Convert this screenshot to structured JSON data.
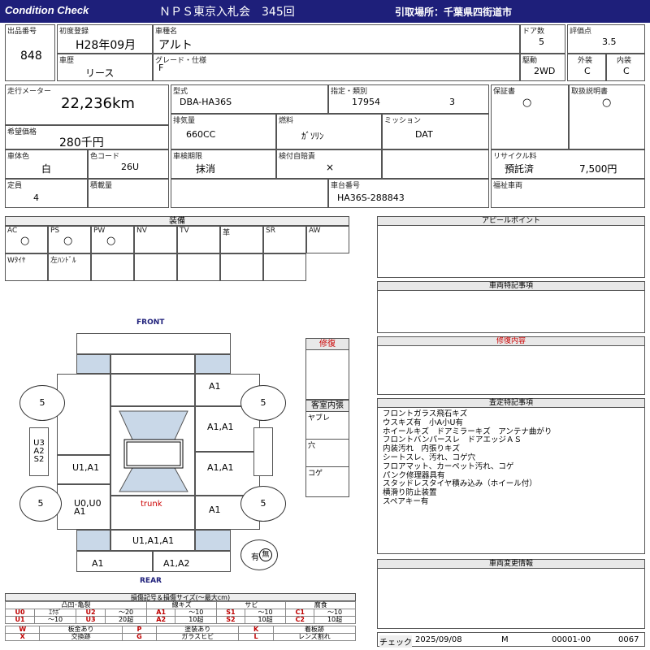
{
  "header": {
    "logo": "Condition Check",
    "auction": "ＮＰＳ東京入札会　345回",
    "pickup": "引取場所：千葉県四街道市"
  },
  "fields": {
    "lot_label": "出品番号",
    "lot": "848",
    "first_reg_label": "初度登録",
    "first_reg": "H28年09月",
    "name_label": "車種名",
    "name": "アルト",
    "doors_label": "ドア数",
    "doors": "5",
    "rating_label": "評価点",
    "rating": "3.5",
    "history_label": "車歴",
    "history": "リース",
    "grade_label": "グレード・仕様",
    "grade": "F",
    "drive_label": "駆動",
    "drive": "2WD",
    "ext_label": "外装",
    "ext": "C",
    "int_label": "内装",
    "int": "C",
    "mileage_label": "走行メーター",
    "mileage": "22,236km",
    "model_label": "型式",
    "model": "DBA-HA36S",
    "designation_label": "指定・類別",
    "designation": "17954",
    "category": "3",
    "warranty_label": "保証書",
    "warranty": "○",
    "manual_label": "取扱説明書",
    "manual": "○",
    "price_label": "希望価格",
    "price": "280千円",
    "displacement_label": "排気量",
    "displacement": "660CC",
    "fuel_label": "燃料",
    "fuel": "ｶﾞｿﾘﾝ",
    "mission_label": "ミッション",
    "mission": "DAT",
    "color_label": "車体色",
    "color": "白",
    "colorcode_label": "色コード",
    "colorcode": "26U",
    "inspection_label": "車検期限",
    "inspection": "抹消",
    "insurance_label": "検付自賠責",
    "insurance": "×",
    "recycle_label": "リサイクル料",
    "recycle_status": "預託済",
    "recycle_fee": "7,500円",
    "capacity_label": "定員",
    "capacity": "4",
    "load_label": "積載量",
    "chassis_label": "車台番号",
    "chassis": "HA36S-288843",
    "welfare_label": "福祉車両"
  },
  "equipment": {
    "title": "装備",
    "row1": [
      {
        "label": "AC",
        "mark": "○"
      },
      {
        "label": "PS",
        "mark": "○"
      },
      {
        "label": "PW",
        "mark": "○"
      },
      {
        "label": "NV",
        "mark": ""
      },
      {
        "label": "TV",
        "mark": ""
      },
      {
        "label": "革",
        "mark": ""
      },
      {
        "label": "SR",
        "mark": ""
      },
      {
        "label": "AW",
        "mark": ""
      }
    ],
    "row2": [
      {
        "label": "Wﾀｲﾔ"
      },
      {
        "label": "左ﾊﾝﾄﾞﾙ"
      },
      {
        "label": ""
      },
      {
        "label": ""
      },
      {
        "label": ""
      },
      {
        "label": ""
      },
      {
        "label": ""
      }
    ]
  },
  "diagram": {
    "front": "FRONT",
    "rear": "REAR",
    "trunk": "trunk",
    "tires": [
      "5",
      "5",
      "5",
      "5"
    ],
    "side_glass": [
      "U3",
      "A2",
      "S2"
    ],
    "marks": {
      "fl_fender": "A1",
      "f_door_r": "A1,A1",
      "r_door_r": "A1,A1",
      "q_r": "A1",
      "f_door_l": "U1,A1",
      "q_l": "U0,U0\nA1",
      "rear_bumper": "U1,A1,A1",
      "rl": "A1",
      "rr": "A1,A2"
    },
    "spare": "有",
    "spare_mark": "無"
  },
  "repair": {
    "title": "修復"
  },
  "interior": {
    "title": "客室内張",
    "items": [
      "ヤブレ",
      "穴",
      "コゲ"
    ]
  },
  "panels": {
    "appeal": {
      "title": "アピールポイント",
      "text": ""
    },
    "special": {
      "title": "車両特記事項",
      "text": ""
    },
    "repair_detail": {
      "title": "修復内容",
      "text": ""
    },
    "inspection": {
      "title": "査定特記事項",
      "lines": [
        "フロントガラス飛石キズ",
        "ウスキズ有　小A小U有",
        "ホイールキズ　ドアミラーキズ　アンテナ曲がり",
        "フロントバンパースレ　ドアエッジＡＳ",
        "内装汚れ　内張りキズ",
        "シートスレ、汚れ、コゲ穴",
        "フロアマット、カーペット汚れ、コゲ",
        "パンク修理器具有",
        "スタッドレスタイヤ積み込み（ホイール付）",
        "横滑り防止装置",
        "スペアキー有"
      ]
    },
    "change": {
      "title": "車両変更情報",
      "text": ""
    }
  },
  "legend": {
    "title": "損傷記号＆損傷サイズ(～最大cm)",
    "groups": [
      "凸凹･亀裂",
      "線キズ",
      "サビ",
      "腐食"
    ],
    "rows": [
      [
        "U0",
        "ｴｸﾎﾞ",
        "U2",
        "～20",
        "A1",
        "～10",
        "S1",
        "～10",
        "C1",
        "～10"
      ],
      [
        "U1",
        "～10",
        "U3",
        "20超",
        "A2",
        "10超",
        "S2",
        "10超",
        "C2",
        "10超"
      ]
    ],
    "codes": [
      [
        "W",
        "板金あり",
        "P",
        "塗装あり",
        "K",
        "着板跡"
      ],
      [
        "X",
        "交換跡",
        "G",
        "ガラスヒビ",
        "L",
        "レンズ割れ"
      ]
    ]
  },
  "footer": {
    "check": "チェック",
    "date": "2025/09/08",
    "inspector": "M",
    "id": "00001-00",
    "number": "0067"
  }
}
